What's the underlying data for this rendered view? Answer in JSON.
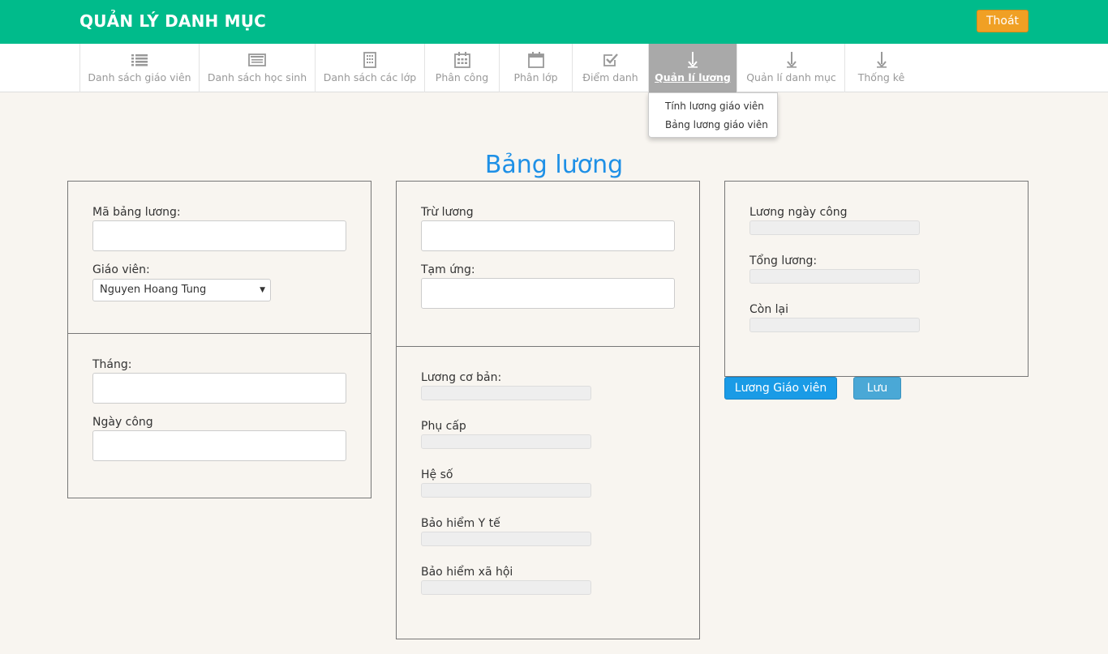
{
  "header": {
    "title": "QUẢN LÝ DANH MỤC",
    "logout_label": "Thoát",
    "brand_color": "#00bb8b",
    "logout_color": "#f0a024"
  },
  "nav": {
    "items": [
      {
        "label": "Danh sách giáo viên",
        "icon": "list-icon"
      },
      {
        "label": "Danh sách học sinh",
        "icon": "id-card-icon"
      },
      {
        "label": "Danh sách các lớp",
        "icon": "building-icon"
      },
      {
        "label": "Phân công",
        "icon": "calendar-grid-icon"
      },
      {
        "label": "Phân lớp",
        "icon": "calendar-icon"
      },
      {
        "label": "Điểm danh",
        "icon": "check-square-icon"
      },
      {
        "label": "Quản lí lương",
        "icon": "arrow-down-icon",
        "active": true
      },
      {
        "label": "Quản lí danh mục",
        "icon": "arrow-down-icon"
      },
      {
        "label": "Thống kê",
        "icon": "arrow-down-icon"
      }
    ],
    "dropdown": [
      "Tính lương giáo viên",
      "Bảng lương giáo viên"
    ]
  },
  "page": {
    "title": "Bảng lương",
    "title_color": "#1e90e6"
  },
  "form": {
    "ma_bang_luong": {
      "label": "Mã bảng lương:",
      "value": ""
    },
    "giao_vien": {
      "label": "Giáo viên:",
      "value": "Nguyen Hoang Tung"
    },
    "thang": {
      "label": "Tháng:",
      "value": ""
    },
    "ngay_cong": {
      "label": "Ngày công",
      "value": ""
    },
    "tru_luong": {
      "label": "Trừ lương",
      "value": ""
    },
    "tam_ung": {
      "label": "Tạm ứng:",
      "value": ""
    },
    "luong_co_ban": {
      "label": "Lương cơ bản:",
      "value": ""
    },
    "phu_cap": {
      "label": "Phụ cấp",
      "value": ""
    },
    "he_so": {
      "label": "Hệ số",
      "value": ""
    },
    "bao_hiem_yte": {
      "label": "Bảo hiểm Y tế",
      "value": ""
    },
    "bao_hiem_xahoi": {
      "label": "Bảo hiểm xã hội",
      "value": ""
    },
    "luong_ngay_cong": {
      "label": "Lương ngày công",
      "value": ""
    },
    "tong_luong": {
      "label": "Tổng lương:",
      "value": ""
    },
    "con_lai": {
      "label": "Còn lại",
      "value": ""
    }
  },
  "actions": {
    "teacher_salary_label": "Lương Giáo viên",
    "save_label": "Lưu"
  }
}
